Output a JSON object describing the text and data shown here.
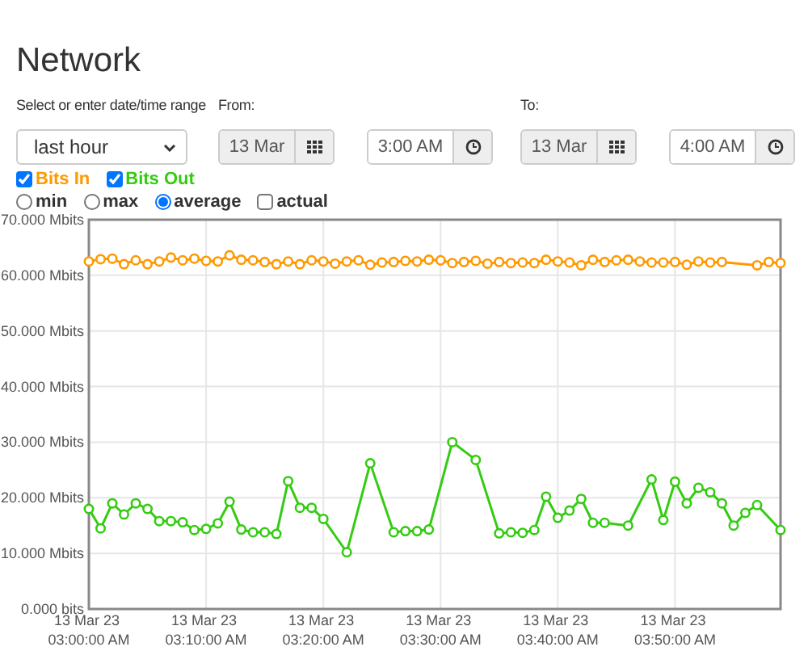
{
  "title": "Network",
  "range": {
    "label": "Select or enter date/time range",
    "value": "last hour"
  },
  "from": {
    "label": "From:",
    "date": "13 Mar",
    "time": "3:00 AM"
  },
  "to": {
    "label": "To:",
    "date": "13 Mar",
    "time": "4:00 AM"
  },
  "series_toggles": [
    {
      "checked": true
    },
    {
      "checked": true
    }
  ],
  "modes": [
    {
      "kind": "radio",
      "label": "min",
      "selected": false
    },
    {
      "kind": "radio",
      "label": "max",
      "selected": false
    },
    {
      "kind": "radio",
      "label": "average",
      "selected": true
    },
    {
      "kind": "checkbox",
      "label": "actual",
      "selected": false
    }
  ],
  "chart_data": {
    "type": "line",
    "categories": [
      "13 Mar 23 03:00:00 AM",
      null,
      null,
      null,
      null,
      null,
      null,
      null,
      null,
      null,
      "13 Mar 23 03:10:00 AM",
      null,
      null,
      null,
      null,
      null,
      null,
      null,
      null,
      null,
      "13 Mar 23 03:20:00 AM",
      null,
      null,
      null,
      null,
      null,
      null,
      null,
      null,
      null,
      "13 Mar 23 03:30:00 AM",
      null,
      null,
      null,
      null,
      null,
      null,
      null,
      null,
      null,
      "13 Mar 23 03:40:00 AM",
      null,
      null,
      null,
      null,
      null,
      null,
      null,
      null,
      null,
      "13 Mar 23 03:50:00 AM",
      null,
      null,
      null,
      null,
      null,
      null,
      null,
      null,
      null
    ],
    "ylim": [
      0,
      70
    ],
    "grid": true,
    "yticks": [
      {
        "value": 0,
        "label": "0.000 bits"
      },
      {
        "value": 10,
        "label": "10.000 Mbits"
      },
      {
        "value": 20,
        "label": "20.000 Mbits"
      },
      {
        "value": 30,
        "label": "30.000 Mbits"
      },
      {
        "value": 40,
        "label": "40.000 Mbits"
      },
      {
        "value": 50,
        "label": "50.000 Mbits"
      },
      {
        "value": 60,
        "label": "60.000 Mbits"
      },
      {
        "value": 70,
        "label": "70.000 Mbits"
      }
    ],
    "series": [
      {
        "name": "Bits In",
        "color": "#ff9900",
        "marker": "circle",
        "values": [
          62.5,
          62.9,
          63,
          62,
          62.7,
          62,
          62.5,
          63.2,
          62.7,
          63,
          62.6,
          62.5,
          63.6,
          62.8,
          62.7,
          62.4,
          62,
          62.5,
          62,
          62.7,
          62.5,
          62.1,
          62.5,
          62.7,
          61.9,
          62.3,
          62.4,
          62.6,
          62.5,
          62.8,
          62.7,
          62.2,
          62.4,
          62.6,
          62.1,
          62.4,
          62.2,
          62.3,
          62.2,
          62.8,
          62.5,
          62.3,
          61.8,
          62.8,
          62.4,
          62.7,
          62.8,
          62.5,
          62.3,
          62.3,
          62.4,
          61.9,
          62.5,
          62.3,
          62.4,
          null,
          null,
          61.8,
          62.4,
          62.2
        ]
      },
      {
        "name": "Bits Out",
        "color": "#33cc11",
        "marker": "circle",
        "values": [
          18,
          14.5,
          19,
          17,
          19,
          18,
          15.8,
          15.8,
          15.6,
          14.2,
          14.4,
          15.4,
          19.3,
          14.3,
          13.8,
          13.8,
          13.5,
          23,
          18.2,
          18.2,
          16.2,
          null,
          10.2,
          null,
          26.2,
          null,
          13.8,
          14,
          14,
          14.3,
          null,
          30,
          null,
          26.8,
          null,
          13.6,
          13.8,
          13.7,
          14.2,
          20.2,
          16.4,
          17.7,
          19.8,
          15.5,
          15.5,
          null,
          15,
          null,
          23.3,
          16,
          22.9,
          19,
          21.8,
          21,
          19,
          15,
          17.3,
          18.7,
          null,
          14.2
        ]
      }
    ]
  }
}
